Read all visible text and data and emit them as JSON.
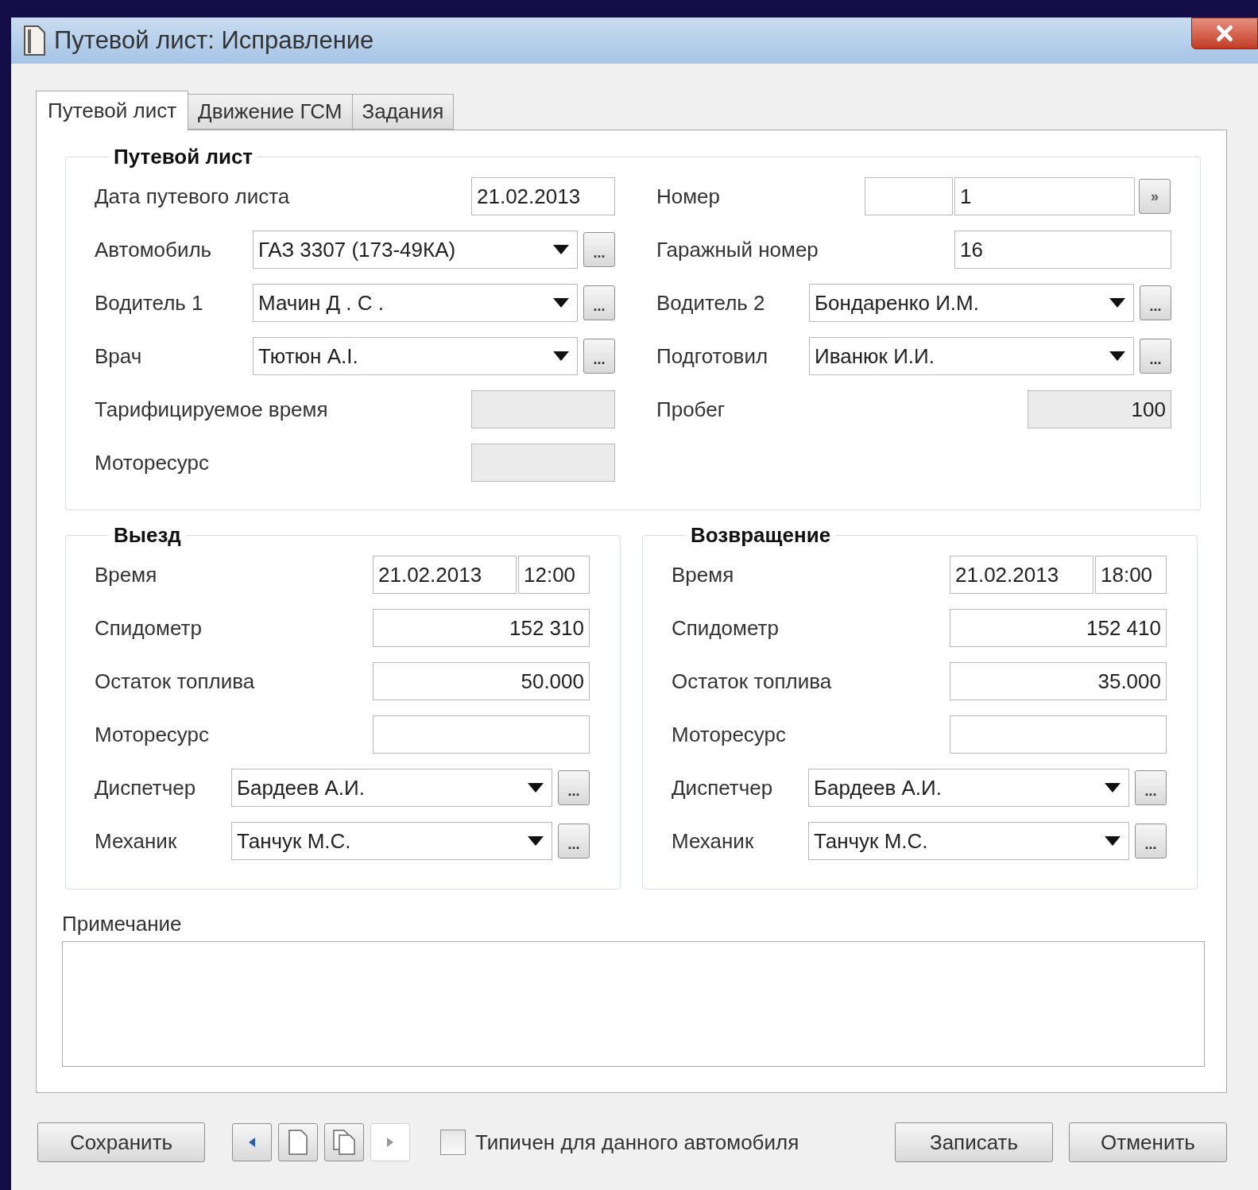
{
  "window": {
    "title": "Путевой лист: Исправление"
  },
  "tabs": [
    {
      "label": "Путевой лист",
      "selected": true
    },
    {
      "label": "Движение ГСМ",
      "selected": false
    },
    {
      "label": "Задания",
      "selected": false
    }
  ],
  "waybill": {
    "title": "Путевой лист",
    "left": [
      {
        "kind": "date",
        "label": "Дата путевого листа",
        "value": "21.02.2013"
      },
      {
        "kind": "combo",
        "label": "Автомобиль",
        "value": "ГАЗ 3307 (173-49КА)",
        "button": "..."
      },
      {
        "kind": "combo",
        "label": "Водитель 1",
        "value": "Мачин Д . С .",
        "button": "..."
      },
      {
        "kind": "combo",
        "label": "Врач",
        "value": "Тютюн А.I.",
        "button": "..."
      },
      {
        "kind": "readonly",
        "label": "Тарифицируемое время"
      },
      {
        "kind": "readonly",
        "label": "Моторесурс"
      }
    ],
    "right": [
      {
        "kind": "split",
        "label": "Номер",
        "value": "1",
        "button": "»"
      },
      {
        "kind": "text",
        "label": "Гаражный номер",
        "value": "16"
      },
      {
        "kind": "combo",
        "label": "Водитель 2",
        "value": "Бондаренко И.М.",
        "button": "..."
      },
      {
        "kind": "combo",
        "label": "Подготовил",
        "value": "Иванюк И.И.",
        "button": "..."
      },
      {
        "kind": "readonly",
        "label": "Пробег",
        "value": "100"
      }
    ]
  },
  "trips": [
    {
      "title": "Выезд",
      "rows": [
        {
          "kind": "datetime",
          "label": "Время",
          "date": "21.02.2013",
          "time": "12:00"
        },
        {
          "kind": "number",
          "label": "Спидометр",
          "value": "152 310"
        },
        {
          "kind": "number",
          "label": "Остаток топлива",
          "value": "50.000"
        },
        {
          "kind": "number",
          "label": "Моторесурс"
        },
        {
          "kind": "combo",
          "label": "Диспетчер",
          "value": "Бардеев А.И.",
          "button": "..."
        },
        {
          "kind": "combo",
          "label": "Механик",
          "value": "Танчук М.С.",
          "button": "..."
        }
      ]
    },
    {
      "title": "Возвращение",
      "rows": [
        {
          "kind": "datetime",
          "label": "Время",
          "date": "21.02.2013",
          "time": "18:00"
        },
        {
          "kind": "number",
          "label": "Спидометр",
          "value": "152 410"
        },
        {
          "kind": "number",
          "label": "Остаток топлива",
          "value": "35.000"
        },
        {
          "kind": "number",
          "label": "Моторесурс"
        },
        {
          "kind": "combo",
          "label": "Диспетчер",
          "value": "Бардеев А.И.",
          "button": "..."
        },
        {
          "kind": "combo",
          "label": "Механик",
          "value": "Танчук М.С.",
          "button": "..."
        }
      ]
    }
  ],
  "note": {
    "label": "Примечание"
  },
  "footer": {
    "save": "Сохранить",
    "nav": [
      {
        "kind": "prev",
        "disabled": false
      },
      {
        "kind": "new",
        "disabled": false
      },
      {
        "kind": "copy",
        "disabled": false
      },
      {
        "kind": "next",
        "disabled": true
      }
    ],
    "typical": {
      "label": "Типичен для данного автомобиля",
      "checked": false
    },
    "buttons": [
      "Записать",
      "Отменить"
    ]
  }
}
